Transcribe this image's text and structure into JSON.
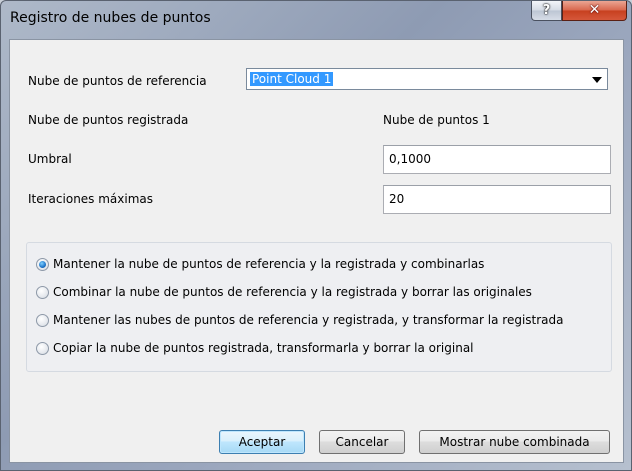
{
  "window": {
    "title": "Registro de nubes de puntos",
    "help_label": "?",
    "close_label": "✕"
  },
  "form": {
    "reference_label": "Nube de puntos de referencia",
    "reference_value": "Point Cloud 1",
    "registered_label": "Nube de puntos registrada",
    "registered_value": "Nube de puntos 1",
    "threshold_label": "Umbral",
    "threshold_value": "0,1000",
    "max_iterations_label": "Iteraciones máximas",
    "max_iterations_value": "20"
  },
  "options": {
    "selected_index": 0,
    "items": [
      {
        "label": "Mantener la nube de puntos de referencia y la registrada y combinarlas"
      },
      {
        "label": "Combinar la nube de puntos de referencia y la registrada y borrar las originales"
      },
      {
        "label": "Mantener las nubes de puntos de referencia y registrada, y transformar la registrada"
      },
      {
        "label": "Copiar la nube de puntos registrada, transformarla y borrar la original"
      }
    ]
  },
  "buttons": {
    "accept": "Aceptar",
    "cancel": "Cancelar",
    "show_combined": "Mostrar nube combinada"
  }
}
